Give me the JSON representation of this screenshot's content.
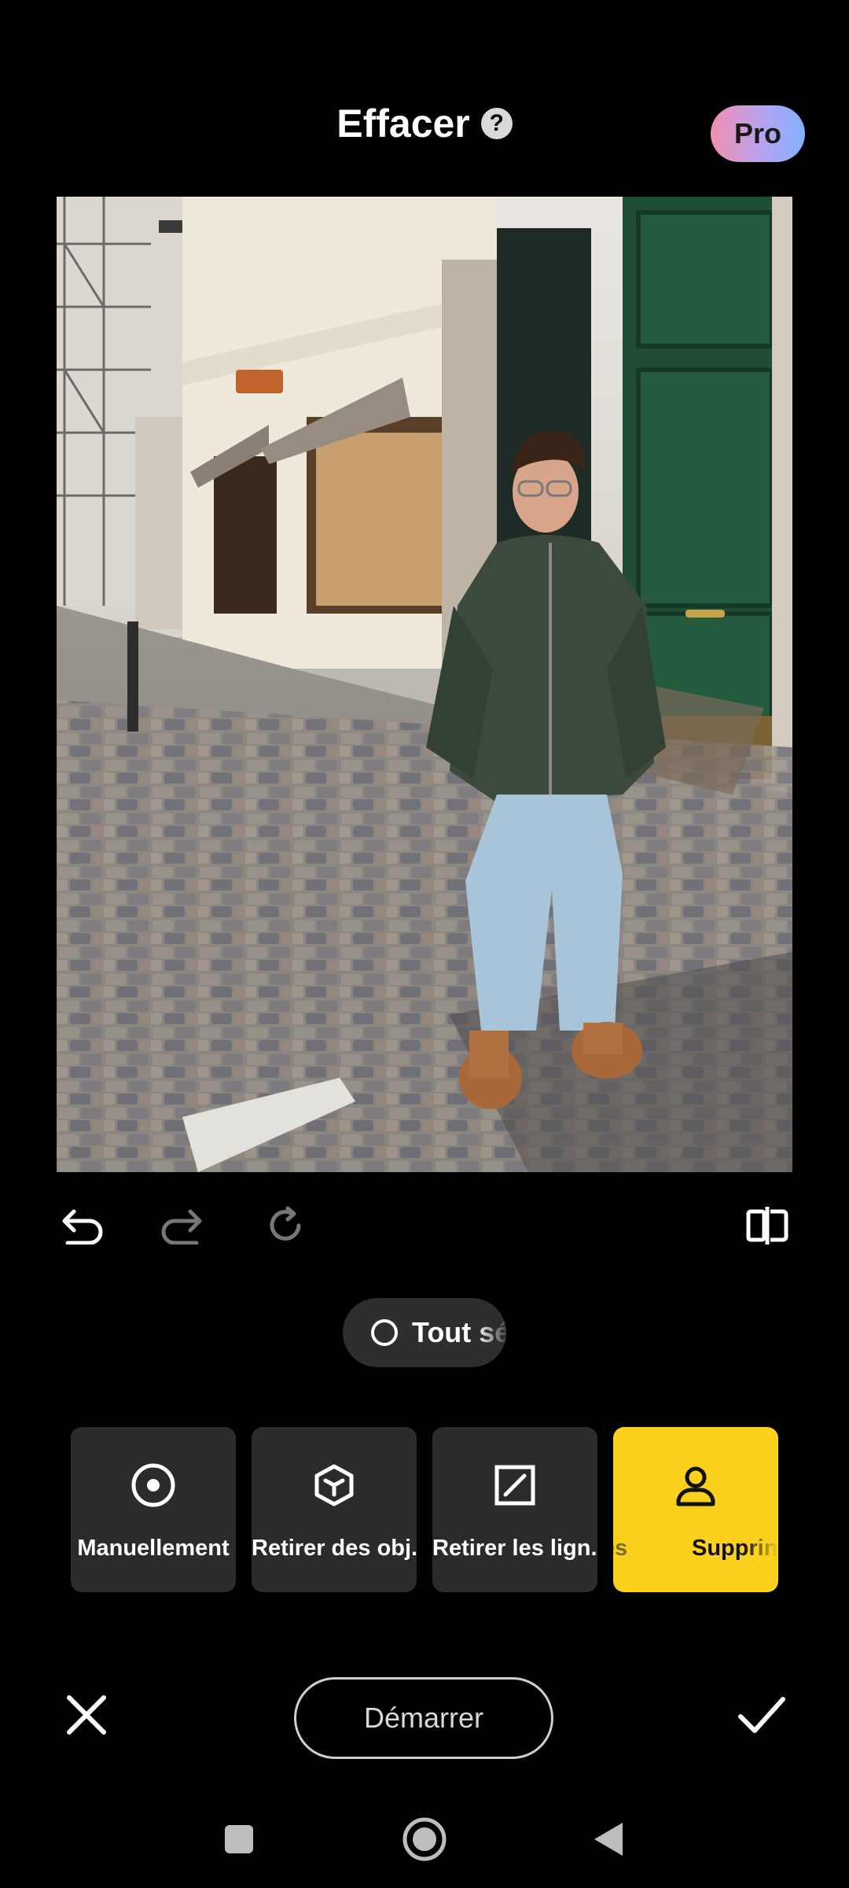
{
  "header": {
    "title": "Effacer",
    "help_icon": "question-mark",
    "pro_label": "Pro"
  },
  "toolbar": {
    "icons": [
      "undo-icon",
      "redo-icon",
      "reset-icon",
      "compare-icon"
    ]
  },
  "select_all": {
    "label": "Tout sé"
  },
  "modes": [
    {
      "label": "Manuellement",
      "icon": "target-circle-icon"
    },
    {
      "label": "Retirer des obj..",
      "icon": "cube-icon"
    },
    {
      "label": "Retirer les lign..",
      "icon": "line-square-icon"
    },
    {
      "label_left": "es",
      "label_right": "Supprin",
      "icon": "person-icon",
      "active": true
    }
  ],
  "actions": {
    "start_label": "Démarrer"
  },
  "colors": {
    "accent": "#fbd11d",
    "card_bg": "#2b2b2b",
    "background": "#000000"
  }
}
